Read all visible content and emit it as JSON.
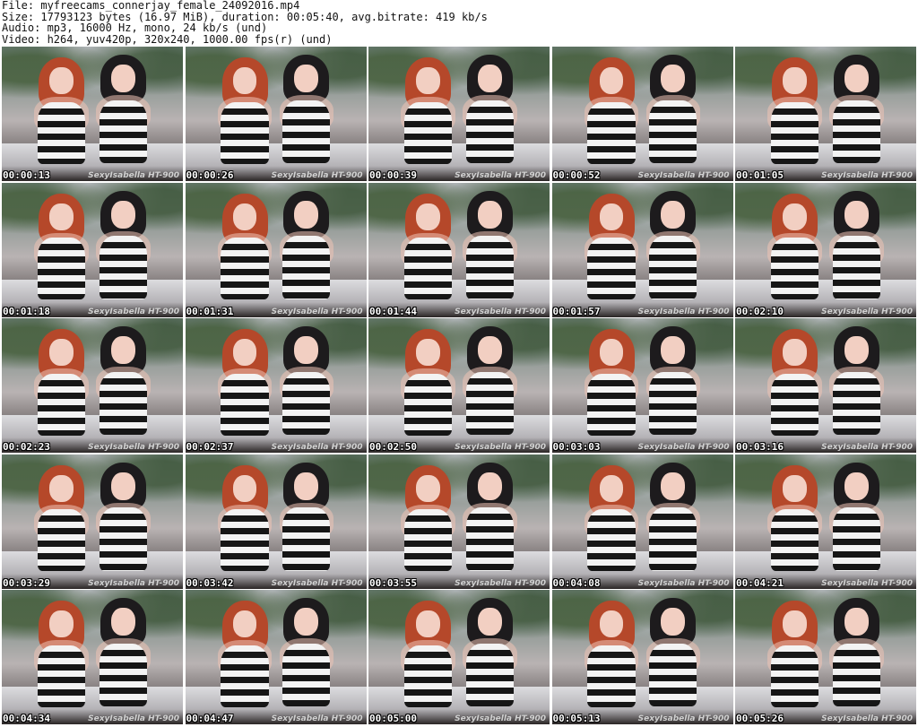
{
  "header": {
    "file": "File: myfreecams_connerjay_female_24092016.mp4",
    "size": "Size: 17793123 bytes (16.97 MiB), duration: 00:05:40, avg.bitrate: 419 kb/s",
    "audio": "Audio: mp3, 16000 Hz, mono, 24 kb/s (und)",
    "video": "Video: h264, yuv420p, 320x240, 1000.00 fps(r) (und)"
  },
  "watermark": "SexyIsabella HT-900",
  "thumbnails": [
    {
      "time": "00:00:13"
    },
    {
      "time": "00:00:26"
    },
    {
      "time": "00:00:39"
    },
    {
      "time": "00:00:52"
    },
    {
      "time": "00:01:05"
    },
    {
      "time": "00:01:18"
    },
    {
      "time": "00:01:31"
    },
    {
      "time": "00:01:44"
    },
    {
      "time": "00:01:57"
    },
    {
      "time": "00:02:10"
    },
    {
      "time": "00:02:23"
    },
    {
      "time": "00:02:37"
    },
    {
      "time": "00:02:50"
    },
    {
      "time": "00:03:03"
    },
    {
      "time": "00:03:16"
    },
    {
      "time": "00:03:29"
    },
    {
      "time": "00:03:42"
    },
    {
      "time": "00:03:55"
    },
    {
      "time": "00:04:08"
    },
    {
      "time": "00:04:21"
    },
    {
      "time": "00:04:34"
    },
    {
      "time": "00:04:47"
    },
    {
      "time": "00:05:00"
    },
    {
      "time": "00:05:13"
    },
    {
      "time": "00:05:26"
    }
  ]
}
